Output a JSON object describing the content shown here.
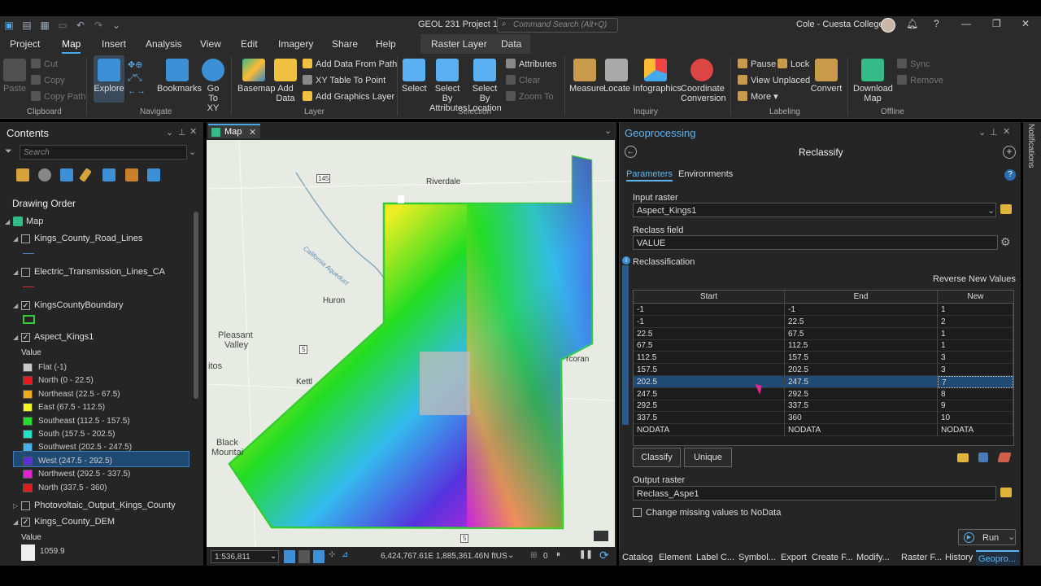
{
  "title_bar": {
    "title": "GEOL 231 Project 1",
    "search_placeholder": "Command Search (Alt+Q)",
    "user": "Cole - Cuesta College"
  },
  "ribbon_tabs": [
    "Project",
    "Map",
    "Insert",
    "Analysis",
    "View",
    "Edit",
    "Imagery",
    "Share",
    "Help",
    "Raster Layer",
    "Data"
  ],
  "ribbon": {
    "clipboard": {
      "paste": "Paste",
      "cut": "Cut",
      "copy": "Copy",
      "copy_path": "Copy Path",
      "group": "Clipboard"
    },
    "navigate": {
      "explore": "Explore",
      "bookmarks": "Bookmarks",
      "goto_1": "Go",
      "goto_2": "To XY",
      "group": "Navigate"
    },
    "layer": {
      "basemap": "Basemap",
      "add_data_1": "Add",
      "add_data_2": "Data",
      "add_from_path": "Add Data From Path",
      "xy_table": "XY Table To Point",
      "add_graphics": "Add Graphics Layer",
      "group": "Layer"
    },
    "selection": {
      "select": "Select",
      "select_by_attr_1": "Select By",
      "select_by_attr_2": "Attributes",
      "select_by_loc_1": "Select By",
      "select_by_loc_2": "Location",
      "attributes": "Attributes",
      "clear": "Clear",
      "zoom_to": "Zoom To",
      "group": "Selection"
    },
    "inquiry": {
      "measure": "Measure",
      "locate": "Locate",
      "infographics": "Infographics",
      "coord_1": "Coordinate",
      "coord_2": "Conversion",
      "group": "Inquiry"
    },
    "labeling": {
      "pause": "Pause",
      "lock": "Lock",
      "view_unplaced": "View Unplaced",
      "more": "More",
      "convert": "Convert",
      "group": "Labeling"
    },
    "offline": {
      "download_1": "Download",
      "download_2": "Map",
      "sync": "Sync",
      "remove": "Remove",
      "group": "Offline"
    }
  },
  "contents": {
    "title": "Contents",
    "search_placeholder": "Search",
    "drawing_order": "Drawing Order",
    "map_name": "Map",
    "layers": [
      {
        "name": "Kings_County_Road_Lines",
        "checked": false
      },
      {
        "name": "Electric_Transmission_Lines_CA",
        "checked": false
      },
      {
        "name": "KingsCountyBoundary",
        "checked": true
      },
      {
        "name": "Aspect_Kings1",
        "checked": true
      },
      {
        "name": "Photovoltaic_Output_Kings_County",
        "checked": false
      },
      {
        "name": "Kings_County_DEM",
        "checked": true
      }
    ],
    "legend_value_label": "Value",
    "legend": [
      {
        "label": "Flat (-1)",
        "color": "#c8c8c8"
      },
      {
        "label": "North (0 - 22.5)",
        "color": "#e8191a"
      },
      {
        "label": "Northeast (22.5 - 67.5)",
        "color": "#f5a623"
      },
      {
        "label": "East (67.5 - 112.5)",
        "color": "#f5f521"
      },
      {
        "label": "Southeast (112.5 - 157.5)",
        "color": "#22e022"
      },
      {
        "label": "South (157.5 - 202.5)",
        "color": "#27e0c8"
      },
      {
        "label": "Southwest (202.5 - 247.5)",
        "color": "#3fb2ef"
      },
      {
        "label": "West (247.5 - 292.5)",
        "color": "#5b2ed8"
      },
      {
        "label": "Northwest (292.5 - 337.5)",
        "color": "#e221d9"
      },
      {
        "label": "North (337.5 - 360)",
        "color": "#e8191a"
      }
    ],
    "dem_value_label": "Value",
    "dem_value": "1059.9"
  },
  "map": {
    "tab": "Map",
    "labels": [
      "Riverdale",
      "Huron",
      "Pleasant",
      "Valley",
      "Kettl",
      "Black",
      "Mountai",
      "itos",
      "rcoran",
      "California Aqueduct",
      "145",
      "5",
      "5"
    ],
    "scale": "1:536,811",
    "coords": "6,424,767.61E 1,885,361.46N ftUS",
    "selected_count": "0"
  },
  "geoprocessing": {
    "title": "Geoprocessing",
    "tool": "Reclassify",
    "tabs": [
      "Parameters",
      "Environments"
    ],
    "input_raster_label": "Input raster",
    "input_raster": "Aspect_Kings1",
    "reclass_field_label": "Reclass field",
    "reclass_field": "VALUE",
    "reclassification_label": "Reclassification",
    "reverse_label": "Reverse New Values",
    "columns": [
      "Start",
      "End",
      "New"
    ],
    "rows": [
      [
        "-1",
        "-1",
        "1"
      ],
      [
        "-1",
        "22.5",
        "2"
      ],
      [
        "22.5",
        "67.5",
        "1"
      ],
      [
        "67.5",
        "112.5",
        "1"
      ],
      [
        "112.5",
        "157.5",
        "3"
      ],
      [
        "157.5",
        "202.5",
        "3"
      ],
      [
        "202.5",
        "247.5",
        "7"
      ],
      [
        "247.5",
        "292.5",
        "8"
      ],
      [
        "292.5",
        "337.5",
        "9"
      ],
      [
        "337.5",
        "360",
        "10"
      ],
      [
        "NODATA",
        "NODATA",
        "NODATA"
      ]
    ],
    "selected_row": 6,
    "classify_btn": "Classify",
    "unique_btn": "Unique",
    "output_raster_label": "Output raster",
    "output_raster": "Reclass_Aspe1",
    "change_missing": "Change missing values to NoData",
    "run": "Run"
  },
  "bottom_tabs": [
    "Catalog",
    "Element",
    "Label C...",
    "Symbol...",
    "Export",
    "Create F...",
    "Modify...",
    "Raster F...",
    "History",
    "Geopro..."
  ],
  "notifications": "Notifications"
}
